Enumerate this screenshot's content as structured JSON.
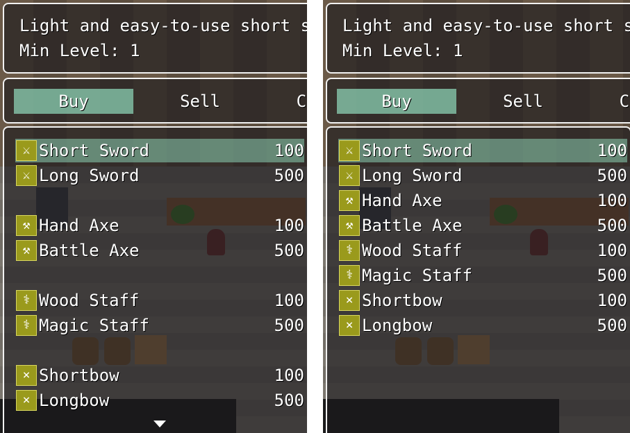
{
  "help_text": {
    "description": "Light and easy-to-use short sword.",
    "min_level": "Min Level: 1"
  },
  "commands": {
    "buy": "Buy",
    "sell": "Sell",
    "cancel": "Cancel"
  },
  "icons": {
    "sword": "sword-icon",
    "axe": "axe-icon",
    "staff": "staff-icon",
    "bow": "bow-icon"
  },
  "colors": {
    "selection": "#8cd2b4",
    "icon_bg": "#9a9a1c",
    "window_border": "#f2f2f2"
  },
  "left_panel": {
    "items": [
      {
        "name": "Short Sword",
        "price": "100",
        "icon": "sword-icon"
      },
      {
        "name": "Long Sword",
        "price": "500",
        "icon": "sword-icon"
      },
      {
        "name": "Hand Axe",
        "price": "100",
        "icon": "axe-icon"
      },
      {
        "name": "Battle Axe",
        "price": "500",
        "icon": "axe-icon"
      },
      {
        "name": "Wood Staff",
        "price": "100",
        "icon": "staff-icon"
      },
      {
        "name": "Magic Staff",
        "price": "500",
        "icon": "staff-icon"
      },
      {
        "name": "Shortbow",
        "price": "100",
        "icon": "bow-icon"
      },
      {
        "name": "Longbow",
        "price": "500",
        "icon": "bow-icon"
      }
    ]
  },
  "right_panel": {
    "items": [
      {
        "name": "Short Sword",
        "price": "100",
        "icon": "sword-icon"
      },
      {
        "name": "Long Sword",
        "price": "500",
        "icon": "sword-icon"
      },
      {
        "name": "Hand Axe",
        "price": "100",
        "icon": "axe-icon"
      },
      {
        "name": "Battle Axe",
        "price": "500",
        "icon": "axe-icon"
      },
      {
        "name": "Wood Staff",
        "price": "100",
        "icon": "staff-icon"
      },
      {
        "name": "Magic Staff",
        "price": "500",
        "icon": "staff-icon"
      },
      {
        "name": "Shortbow",
        "price": "100",
        "icon": "bow-icon"
      },
      {
        "name": "Longbow",
        "price": "500",
        "icon": "bow-icon"
      }
    ]
  }
}
